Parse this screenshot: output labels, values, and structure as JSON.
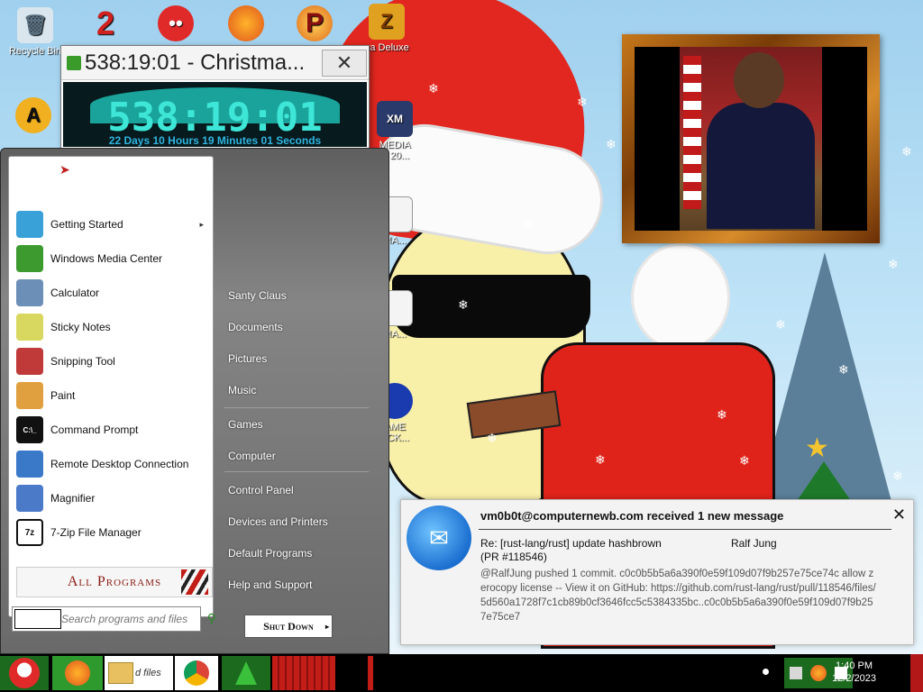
{
  "desktop_icons": {
    "recycle_bin": "Recycle Bin",
    "bejeweled_label": "na Deluxe",
    "xm_label_1": "MEDIA",
    "xm_label_2": "R 20...",
    "ma_label_1": "MA...",
    "ma_label_2": "MA...",
    "game_label_1": "AME",
    "game_label_2": "ACK..."
  },
  "countdown": {
    "window_title": "538:19:01 - Christma...",
    "close_glyph": "✕",
    "big_time": "538:19:01",
    "detail": "22 Days 10 Hours 19 Minutes 01 Seconds"
  },
  "start_menu": {
    "programs": [
      {
        "label": "Getting Started",
        "icon": "getting-started-icon",
        "has_arrow": true,
        "color": "#3aa0d8"
      },
      {
        "label": "Windows Media Center",
        "icon": "windows-media-center-icon",
        "has_arrow": false,
        "color": "#3c9a2f"
      },
      {
        "label": "Calculator",
        "icon": "calculator-icon",
        "has_arrow": false,
        "color": "#6c8fb8"
      },
      {
        "label": "Sticky Notes",
        "icon": "sticky-notes-icon",
        "has_arrow": false,
        "color": "#d8d860"
      },
      {
        "label": "Snipping Tool",
        "icon": "snipping-tool-icon",
        "has_arrow": false,
        "color": "#c03a3a"
      },
      {
        "label": "Paint",
        "icon": "paint-icon",
        "has_arrow": false,
        "color": "#e0a040"
      },
      {
        "label": "Command Prompt",
        "icon": "command-prompt-icon",
        "has_arrow": false,
        "color": "#111111"
      },
      {
        "label": "Remote Desktop Connection",
        "icon": "remote-desktop-icon",
        "has_arrow": false,
        "color": "#3a78c8"
      },
      {
        "label": "Magnifier",
        "icon": "magnifier-icon",
        "has_arrow": false,
        "color": "#4a7ac8"
      },
      {
        "label": "7-Zip File Manager",
        "icon": "seven-zip-icon",
        "has_arrow": false,
        "color": "#222222"
      }
    ],
    "arrow_glyph": "▸",
    "cmd_glyph": "C:\\_",
    "zip_glyph": "7z",
    "all_programs": "All Programs",
    "search_placeholder": "Search programs and files",
    "right_items": [
      "Santy Claus",
      "Documents",
      "Pictures",
      "Music",
      "Games",
      "Computer",
      "Control Panel",
      "Devices and Printers",
      "Default Programs",
      "Help and Support"
    ],
    "shutdown": "Shut Down",
    "shutdown_arrow": "▸"
  },
  "notification": {
    "header": "vm0b0t@computernewb.com received 1 new message",
    "close_glyph": "✕",
    "subject": "Re: [rust-lang/rust] update hashbrown (PR #118546)",
    "sender": "Ralf Jung",
    "body": "@RalfJung pushed 1 commit. c0c0b5b5a6a390f0e59f109d07f9b257e75ce74c allow zerocopy license -- View it on GitHub: https://github.com/rust-lang/rust/pull/118546/files/5d560a1728f7c1cb89b0cf3646fcc5c5384335bc..c0c0b5b5a6a390f0e59f109d07f9b257e75ce7"
  },
  "taskbar": {
    "partial_label": "d files",
    "time": "1:40 PM",
    "date": "12/2/2023"
  },
  "colors": {
    "accent_red": "#c21d16",
    "countdown_text": "#3de6d6",
    "countdown_detail": "#2fb4e0",
    "taskbar": "#000000"
  }
}
